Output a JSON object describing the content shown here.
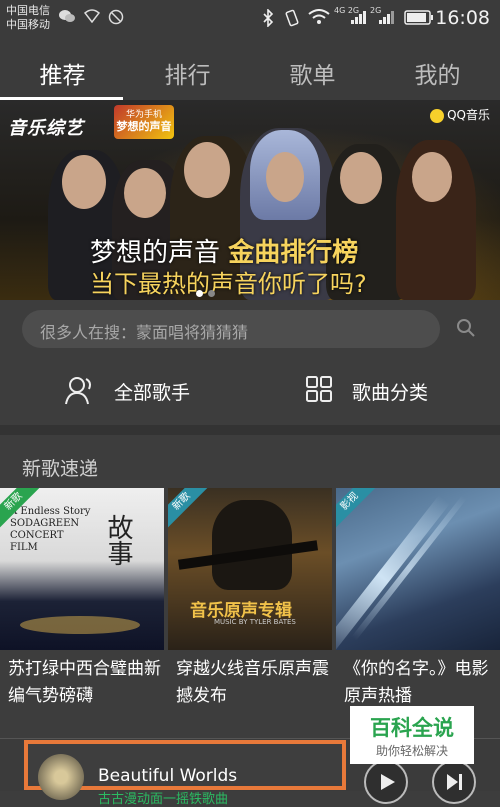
{
  "status_bar": {
    "carrier1": "中国电信",
    "carrier2": "中国移动",
    "network_badges": "4G 2G",
    "network_badge2": "2G",
    "time": "16:08"
  },
  "tabs": [
    {
      "label": "推荐",
      "active": true
    },
    {
      "label": "排行",
      "active": false
    },
    {
      "label": "歌单",
      "active": false
    },
    {
      "label": "我的",
      "active": false
    }
  ],
  "banner": {
    "show_logo": "音乐综艺",
    "show_badge_top": "华为手机",
    "show_badge_name": "梦想的声音",
    "brand": "QQ音乐",
    "headline_prefix": "梦想的声音",
    "headline_gold": "金曲排行榜",
    "headline2": "当下最热的声音你听了吗?",
    "slide_count": 2,
    "active_slide": 1
  },
  "search": {
    "placeholder": "很多人在搜：蒙面唱将猜猜猜"
  },
  "quick_links": [
    {
      "label": "全部歌手",
      "icon": "singer-icon"
    },
    {
      "label": "歌曲分类",
      "icon": "grid-icon"
    }
  ],
  "new_songs": {
    "title": "新歌速递",
    "items": [
      {
        "tag": "新歌",
        "cover_text": "A Endless Story\nSODAGREEN\nCONCERT\nFILM",
        "cover_text2": "故事",
        "title": "苏打绿中西合璧曲新编气势磅礴"
      },
      {
        "tag": "新歌",
        "cover_text": "音乐原声专辑",
        "cover_text2": "MUSIC BY TYLER BATES",
        "title": "穿越火线音乐原声震撼发布"
      },
      {
        "tag": "影视",
        "cover_text": "",
        "cover_text2": "",
        "title": "《你的名字。》电影原声热播"
      }
    ]
  },
  "player": {
    "song": "Beautiful Worlds",
    "subtitle": "古古漫动面一摇铁歌曲"
  },
  "watermark": {
    "title": "百科全说",
    "subtitle": "助你轻松解决"
  }
}
